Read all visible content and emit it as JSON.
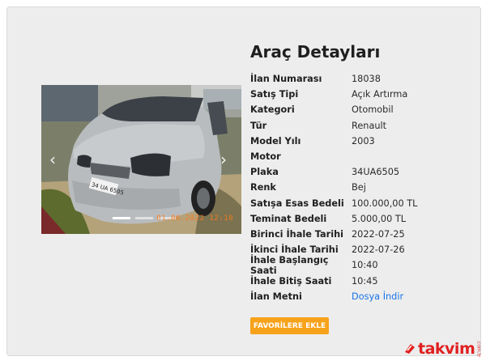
{
  "page": {
    "title": "Araç Detayları",
    "favorite_button": "FAVORİLERE EKLE"
  },
  "photo": {
    "timestamp": "01.06.2022 12:10",
    "plate_text": "34 UA 6505",
    "slides": 3,
    "active_slide": 1
  },
  "details": [
    {
      "label": "İlan Numarası",
      "value": "18038"
    },
    {
      "label": "Satış Tipi",
      "value": "Açık Artırma"
    },
    {
      "label": "Kategori",
      "value": "Otomobil"
    },
    {
      "label": "Tür",
      "value": "Renault"
    },
    {
      "label": "Model Yılı",
      "value": "2003"
    },
    {
      "label": "Motor",
      "value": ""
    },
    {
      "label": "Plaka",
      "value": "34UA6505"
    },
    {
      "label": "Renk",
      "value": "Bej"
    },
    {
      "label": "Satışa Esas Bedeli",
      "value": "100.000,00 TL"
    },
    {
      "label": "Teminat Bedeli",
      "value": "5.000,00 TL"
    },
    {
      "label": "Birinci İhale Tarihi",
      "value": "2022-07-25"
    },
    {
      "label": "İkinci İhale Tarihi",
      "value": "2022-07-26"
    },
    {
      "label": "İhale Başlangıç Saati",
      "value": "10:40"
    },
    {
      "label": "İhale Bitiş Saati",
      "value": "10:45"
    },
    {
      "label": "İlan Metni",
      "value": "Dosya İndir",
      "is_link": true
    }
  ],
  "watermark": {
    "word": "takvim",
    "domain": ".com.tr"
  },
  "colors": {
    "accent_button": "#f7a21b",
    "link": "#1a73e8",
    "card_bg": "#ededed",
    "watermark": "#e02020"
  }
}
